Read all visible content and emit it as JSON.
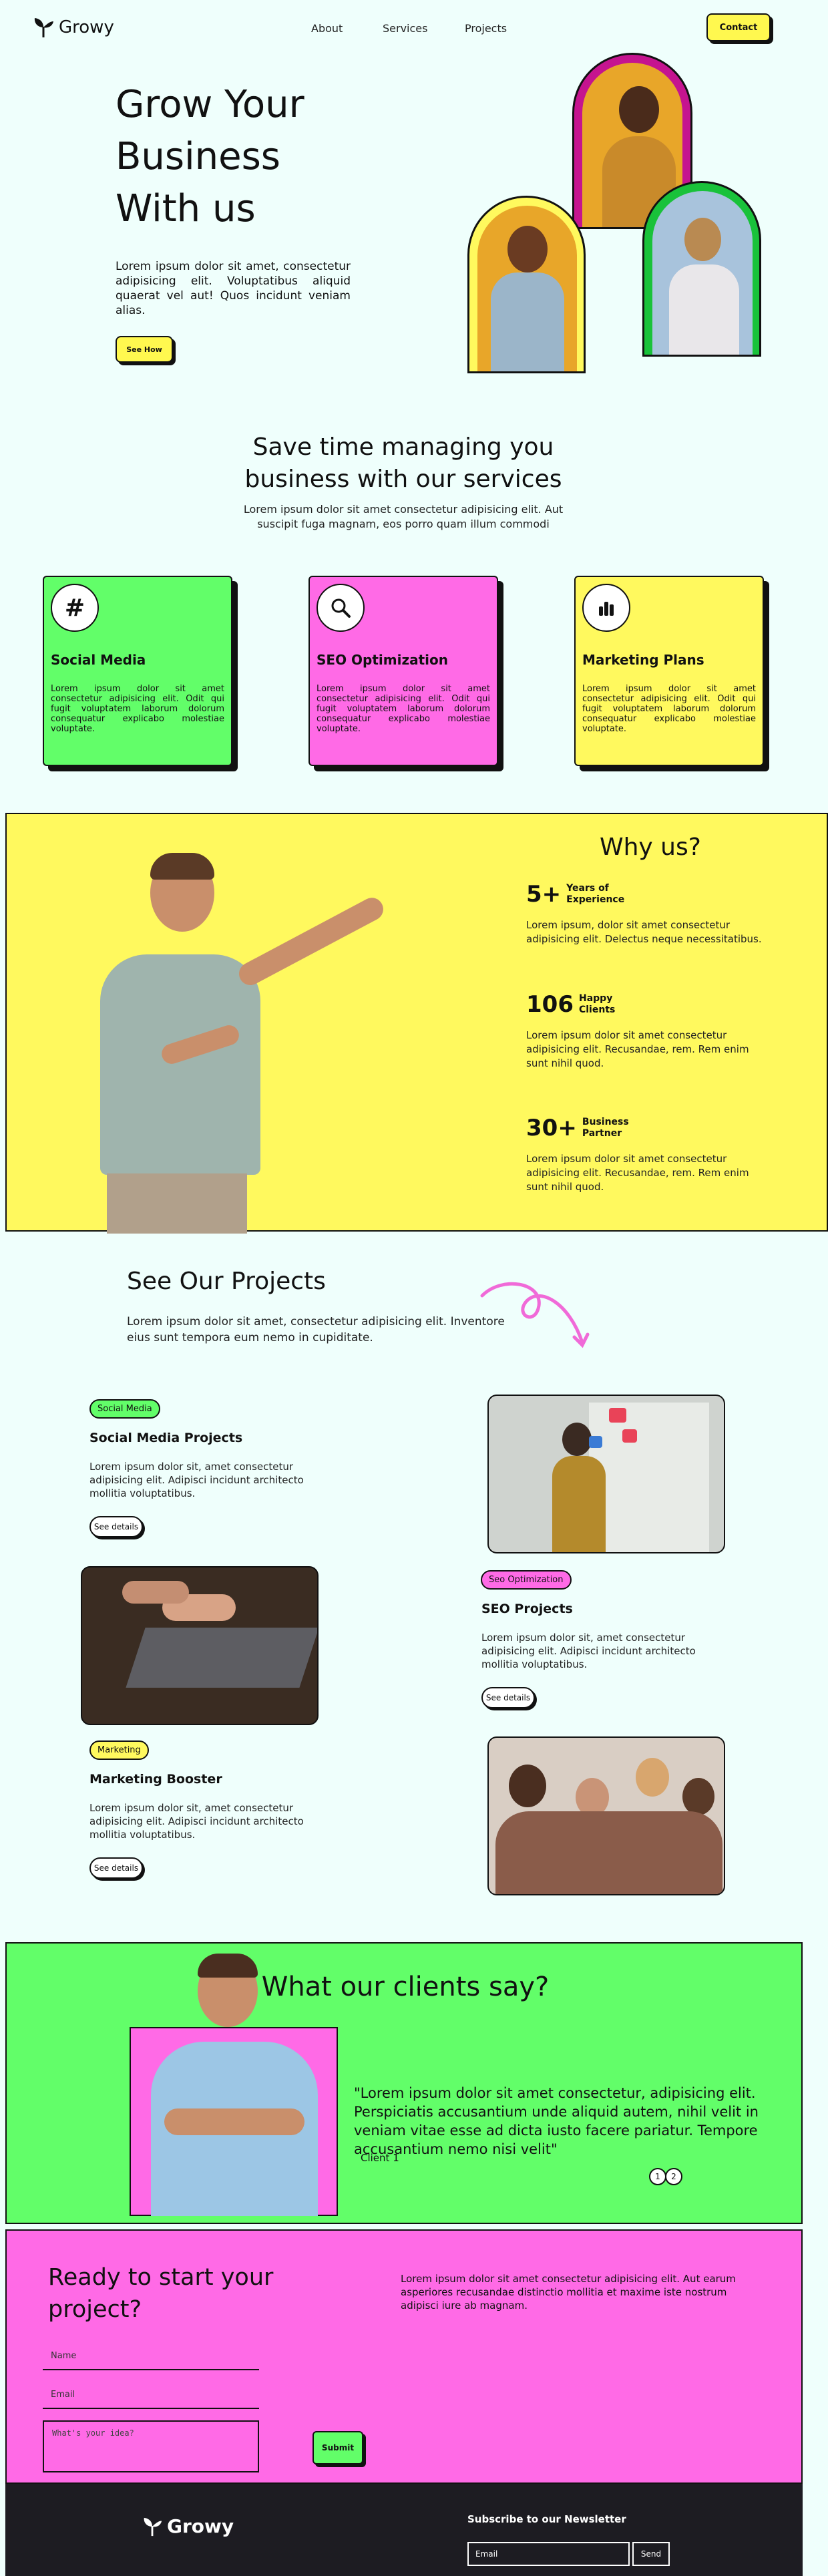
{
  "nav": {
    "brand": "Growy",
    "links": [
      "About",
      "Services",
      "Projects"
    ],
    "cta": "Contact"
  },
  "hero": {
    "title_lines": [
      "Grow Your",
      "Business",
      "With us"
    ],
    "text": "Lorem ipsum dolor sit amet, consectetur adipisicing elit. Voluptatibus aliquid quaerat vel aut! Quos incidunt veniam alias.",
    "button": "See How"
  },
  "services": {
    "title_lines": [
      "Save time managing you",
      "business with our services"
    ],
    "subtitle_lines": [
      "Lorem ipsum dolor sit amet consectetur adipisicing elit. Aut",
      "suscipit fuga magnam, eos porro quam illum commodi"
    ],
    "cards": [
      {
        "title": "Social Media",
        "icon": "hashtag-icon",
        "glyph": "#",
        "color": "#62fe69",
        "text": "Lorem ipsum dolor sit amet consectetur adipisicing elit. Odit qui fugit voluptatem laborum dolorum consequatur explicabo molestiae voluptate."
      },
      {
        "title": "SEO Optimization",
        "icon": "search-icon",
        "glyph": "⌕",
        "color": "#ff6ae6",
        "text": "Lorem ipsum dolor sit amet consectetur adipisicing elit. Odit qui fugit voluptatem laborum dolorum consequatur explicabo molestiae voluptate."
      },
      {
        "title": "Marketing Plans",
        "icon": "bar-chart-icon",
        "glyph": "▮",
        "color": "#fff95e",
        "text": "Lorem ipsum dolor sit amet consectetur adipisicing elit. Odit qui fugit voluptatem laborum dolorum consequatur explicabo molestiae voluptate."
      }
    ]
  },
  "why": {
    "title": "Why us?",
    "stats": [
      {
        "num": "5+",
        "label_lines": [
          "Years of",
          "Experience"
        ],
        "text": "Lorem ipsum, dolor sit amet consectetur adipisicing elit. Delectus neque necessitatibus."
      },
      {
        "num": "106",
        "label_lines": [
          "Happy",
          "Clients"
        ],
        "text": "Lorem ipsum dolor sit amet consectetur adipisicing elit. Recusandae, rem. Rem enim sunt nihil quod."
      },
      {
        "num": "30+",
        "label_lines": [
          "Business",
          "Partner"
        ],
        "text": "Lorem ipsum dolor sit amet consectetur adipisicing elit. Recusandae, rem. Rem enim sunt nihil quod."
      }
    ]
  },
  "projects": {
    "title": "See Our Projects",
    "subtitle": "Lorem ipsum dolor sit amet, consectetur adipisicing elit. Inventore eius sunt tempora eum nemo in cupiditate.",
    "details_label": "See details",
    "items": [
      {
        "badge": "Social Media",
        "badge_color": "#62fe69",
        "title": "Social Media Projects",
        "text": "Lorem ipsum dolor sit, amet consectetur adipisicing elit. Adipisci incidunt architecto mollitia voluptatibus."
      },
      {
        "badge": "Seo Optimization",
        "badge_color": "#ff6ae6",
        "title": "SEO Projects",
        "text": "Lorem ipsum dolor sit, amet consectetur adipisicing elit. Adipisci incidunt architecto mollitia voluptatibus."
      },
      {
        "badge": "Marketing",
        "badge_color": "#fff95e",
        "title": "Marketing Booster",
        "text": "Lorem ipsum dolor sit, amet consectetur adipisicing elit. Adipisci incidunt architecto mollitia voluptatibus."
      }
    ]
  },
  "testimonial": {
    "title": "What our clients say?",
    "quote": "\"Lorem ipsum dolor sit amet consectetur, adipisicing elit. Perspiciatis accusantium unde aliquid autem, nihil velit in veniam vitae esse ad dicta iusto facere pariatur. Tempore accusantium nemo nisi velit\"",
    "client": "Client 1",
    "pages": [
      "1",
      "2"
    ]
  },
  "contact": {
    "title_lines": [
      "Ready to start your",
      "project?"
    ],
    "text": "Lorem ipsum dolor sit amet consectetur adipisicing elit. Aut earum asperiores recusandae distinctio mollitia et maxime iste nostrum adipisci iure ab magnam.",
    "name_placeholder": "Name",
    "email_placeholder": "Email",
    "idea_placeholder": "What's your idea?",
    "submit": "Submit"
  },
  "footer": {
    "brand": "Growy",
    "newsletter_title": "Subscribe to our Newsletter",
    "email_placeholder": "Email",
    "send": "Send"
  },
  "colors": {
    "green": "#62fe69",
    "pink": "#ff6ae6",
    "yellow": "#fff95e",
    "dark": "#1d1c22",
    "background": "#effffc"
  }
}
